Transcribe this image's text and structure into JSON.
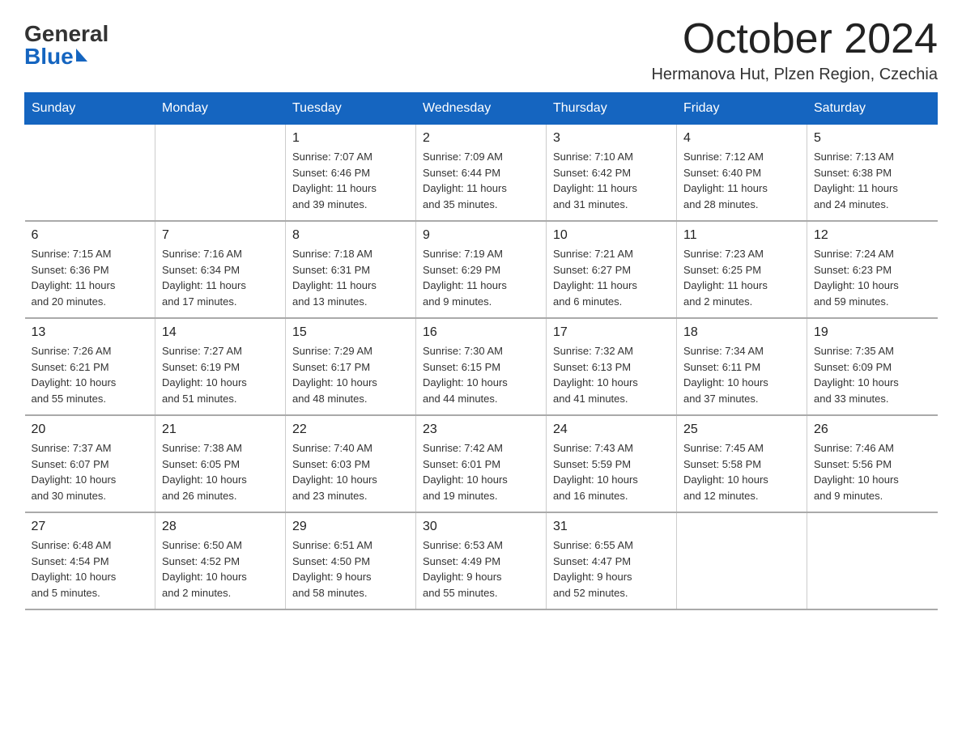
{
  "logo": {
    "general": "General",
    "blue": "Blue",
    "triangle": true
  },
  "header": {
    "month_title": "October 2024",
    "subtitle": "Hermanova Hut, Plzen Region, Czechia"
  },
  "weekdays": [
    "Sunday",
    "Monday",
    "Tuesday",
    "Wednesday",
    "Thursday",
    "Friday",
    "Saturday"
  ],
  "weeks": [
    [
      {
        "day": "",
        "info": ""
      },
      {
        "day": "",
        "info": ""
      },
      {
        "day": "1",
        "info": "Sunrise: 7:07 AM\nSunset: 6:46 PM\nDaylight: 11 hours\nand 39 minutes."
      },
      {
        "day": "2",
        "info": "Sunrise: 7:09 AM\nSunset: 6:44 PM\nDaylight: 11 hours\nand 35 minutes."
      },
      {
        "day": "3",
        "info": "Sunrise: 7:10 AM\nSunset: 6:42 PM\nDaylight: 11 hours\nand 31 minutes."
      },
      {
        "day": "4",
        "info": "Sunrise: 7:12 AM\nSunset: 6:40 PM\nDaylight: 11 hours\nand 28 minutes."
      },
      {
        "day": "5",
        "info": "Sunrise: 7:13 AM\nSunset: 6:38 PM\nDaylight: 11 hours\nand 24 minutes."
      }
    ],
    [
      {
        "day": "6",
        "info": "Sunrise: 7:15 AM\nSunset: 6:36 PM\nDaylight: 11 hours\nand 20 minutes."
      },
      {
        "day": "7",
        "info": "Sunrise: 7:16 AM\nSunset: 6:34 PM\nDaylight: 11 hours\nand 17 minutes."
      },
      {
        "day": "8",
        "info": "Sunrise: 7:18 AM\nSunset: 6:31 PM\nDaylight: 11 hours\nand 13 minutes."
      },
      {
        "day": "9",
        "info": "Sunrise: 7:19 AM\nSunset: 6:29 PM\nDaylight: 11 hours\nand 9 minutes."
      },
      {
        "day": "10",
        "info": "Sunrise: 7:21 AM\nSunset: 6:27 PM\nDaylight: 11 hours\nand 6 minutes."
      },
      {
        "day": "11",
        "info": "Sunrise: 7:23 AM\nSunset: 6:25 PM\nDaylight: 11 hours\nand 2 minutes."
      },
      {
        "day": "12",
        "info": "Sunrise: 7:24 AM\nSunset: 6:23 PM\nDaylight: 10 hours\nand 59 minutes."
      }
    ],
    [
      {
        "day": "13",
        "info": "Sunrise: 7:26 AM\nSunset: 6:21 PM\nDaylight: 10 hours\nand 55 minutes."
      },
      {
        "day": "14",
        "info": "Sunrise: 7:27 AM\nSunset: 6:19 PM\nDaylight: 10 hours\nand 51 minutes."
      },
      {
        "day": "15",
        "info": "Sunrise: 7:29 AM\nSunset: 6:17 PM\nDaylight: 10 hours\nand 48 minutes."
      },
      {
        "day": "16",
        "info": "Sunrise: 7:30 AM\nSunset: 6:15 PM\nDaylight: 10 hours\nand 44 minutes."
      },
      {
        "day": "17",
        "info": "Sunrise: 7:32 AM\nSunset: 6:13 PM\nDaylight: 10 hours\nand 41 minutes."
      },
      {
        "day": "18",
        "info": "Sunrise: 7:34 AM\nSunset: 6:11 PM\nDaylight: 10 hours\nand 37 minutes."
      },
      {
        "day": "19",
        "info": "Sunrise: 7:35 AM\nSunset: 6:09 PM\nDaylight: 10 hours\nand 33 minutes."
      }
    ],
    [
      {
        "day": "20",
        "info": "Sunrise: 7:37 AM\nSunset: 6:07 PM\nDaylight: 10 hours\nand 30 minutes."
      },
      {
        "day": "21",
        "info": "Sunrise: 7:38 AM\nSunset: 6:05 PM\nDaylight: 10 hours\nand 26 minutes."
      },
      {
        "day": "22",
        "info": "Sunrise: 7:40 AM\nSunset: 6:03 PM\nDaylight: 10 hours\nand 23 minutes."
      },
      {
        "day": "23",
        "info": "Sunrise: 7:42 AM\nSunset: 6:01 PM\nDaylight: 10 hours\nand 19 minutes."
      },
      {
        "day": "24",
        "info": "Sunrise: 7:43 AM\nSunset: 5:59 PM\nDaylight: 10 hours\nand 16 minutes."
      },
      {
        "day": "25",
        "info": "Sunrise: 7:45 AM\nSunset: 5:58 PM\nDaylight: 10 hours\nand 12 minutes."
      },
      {
        "day": "26",
        "info": "Sunrise: 7:46 AM\nSunset: 5:56 PM\nDaylight: 10 hours\nand 9 minutes."
      }
    ],
    [
      {
        "day": "27",
        "info": "Sunrise: 6:48 AM\nSunset: 4:54 PM\nDaylight: 10 hours\nand 5 minutes."
      },
      {
        "day": "28",
        "info": "Sunrise: 6:50 AM\nSunset: 4:52 PM\nDaylight: 10 hours\nand 2 minutes."
      },
      {
        "day": "29",
        "info": "Sunrise: 6:51 AM\nSunset: 4:50 PM\nDaylight: 9 hours\nand 58 minutes."
      },
      {
        "day": "30",
        "info": "Sunrise: 6:53 AM\nSunset: 4:49 PM\nDaylight: 9 hours\nand 55 minutes."
      },
      {
        "day": "31",
        "info": "Sunrise: 6:55 AM\nSunset: 4:47 PM\nDaylight: 9 hours\nand 52 minutes."
      },
      {
        "day": "",
        "info": ""
      },
      {
        "day": "",
        "info": ""
      }
    ]
  ]
}
